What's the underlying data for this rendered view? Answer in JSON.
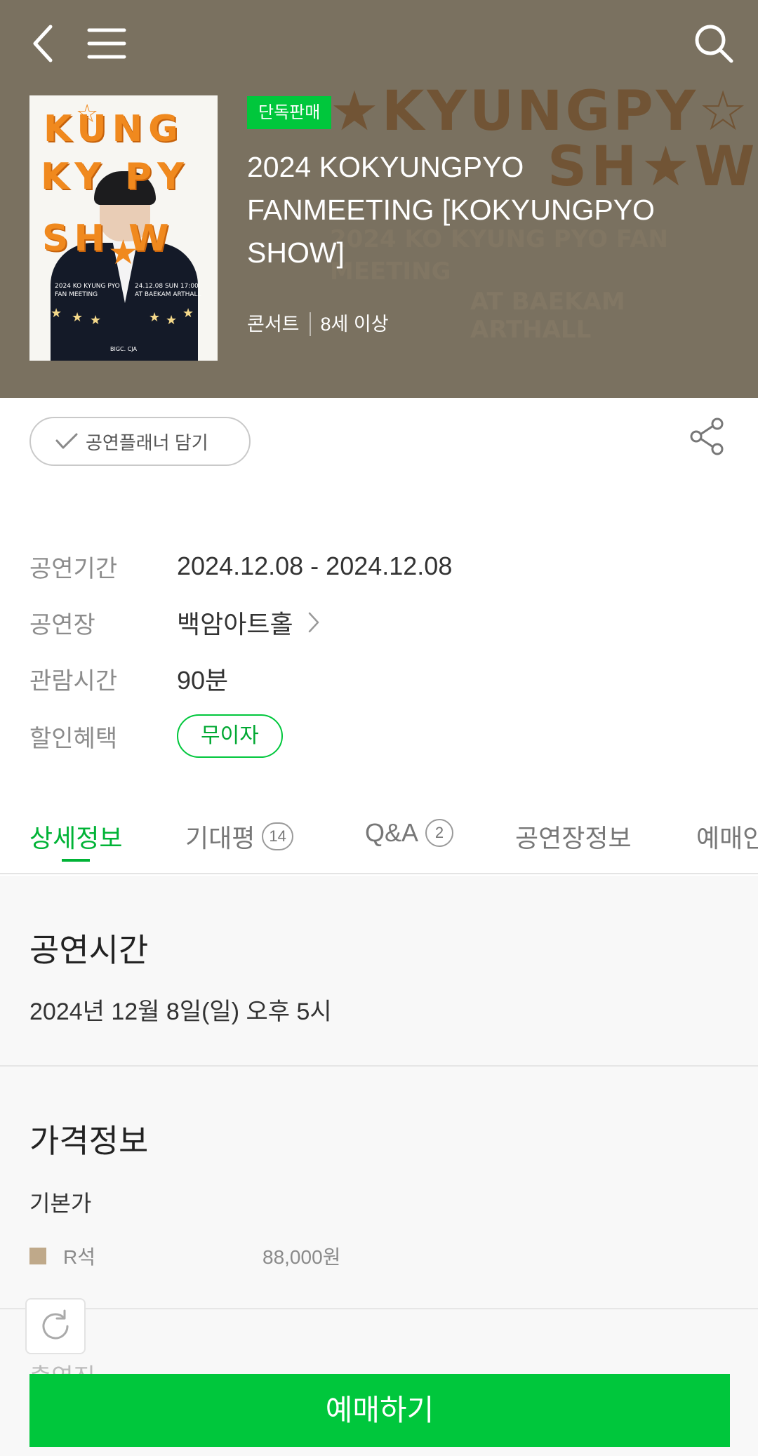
{
  "header": {
    "back_icon": "chevron-left-icon",
    "menu_icon": "hamburger-menu-icon",
    "search_icon": "search-icon"
  },
  "hero": {
    "background_color": "#7a7160",
    "badge": "단독판매",
    "title": "2024 KOKYUNGPYO FANMEETING [KOKYUNGPYO SHOW]",
    "genre": "콘서트",
    "age": "8세 이상",
    "bg_line1": "★KYUNGPY☆",
    "bg_line2": "SH★W",
    "bg_sub1": "2024 KO KYUNG PYO FAN MEETING",
    "bg_sub2": "AT BAEKAM ARTHALL",
    "poster": {
      "line1": "KUNG",
      "line2": "KY PY",
      "line3": "SH W",
      "date_left": "2024 KO KYUNG PYO FAN MEETING",
      "date_right": "24.12.08 SUN 17:00 AT BAEKAM ARTHALL",
      "logo": "BIGC. CJA"
    }
  },
  "actions": {
    "planner_label": "공연플래너 담기",
    "share_icon": "share-icon"
  },
  "info": [
    {
      "label": "공연기간",
      "value": "2024.12.08 - 2024.12.08"
    },
    {
      "label": "공연장",
      "value": "백암아트홀"
    },
    {
      "label": "관람시간",
      "value": "90분"
    },
    {
      "label": "할인혜택",
      "value": "무이자"
    }
  ],
  "tabs": [
    {
      "label": "상세정보",
      "count": ""
    },
    {
      "label": "기대평",
      "count": "14"
    },
    {
      "label": "Q&A",
      "count": "2"
    },
    {
      "label": "공연장정보",
      "count": ""
    },
    {
      "label": "예매안내",
      "count": ""
    }
  ],
  "sections": {
    "time_title": "공연시간",
    "time_text": "2024년 12월 8일(일) 오후 5시",
    "price_title": "가격정보",
    "price_sub": "기본가",
    "price_rows": [
      {
        "seat": "R석",
        "price": "88,000원",
        "color": "#bfa98a"
      }
    ],
    "partial_text": "출연진"
  },
  "footer": {
    "refresh_icon": "refresh-icon",
    "book_label": "예매하기",
    "accent": "#00c73c"
  }
}
